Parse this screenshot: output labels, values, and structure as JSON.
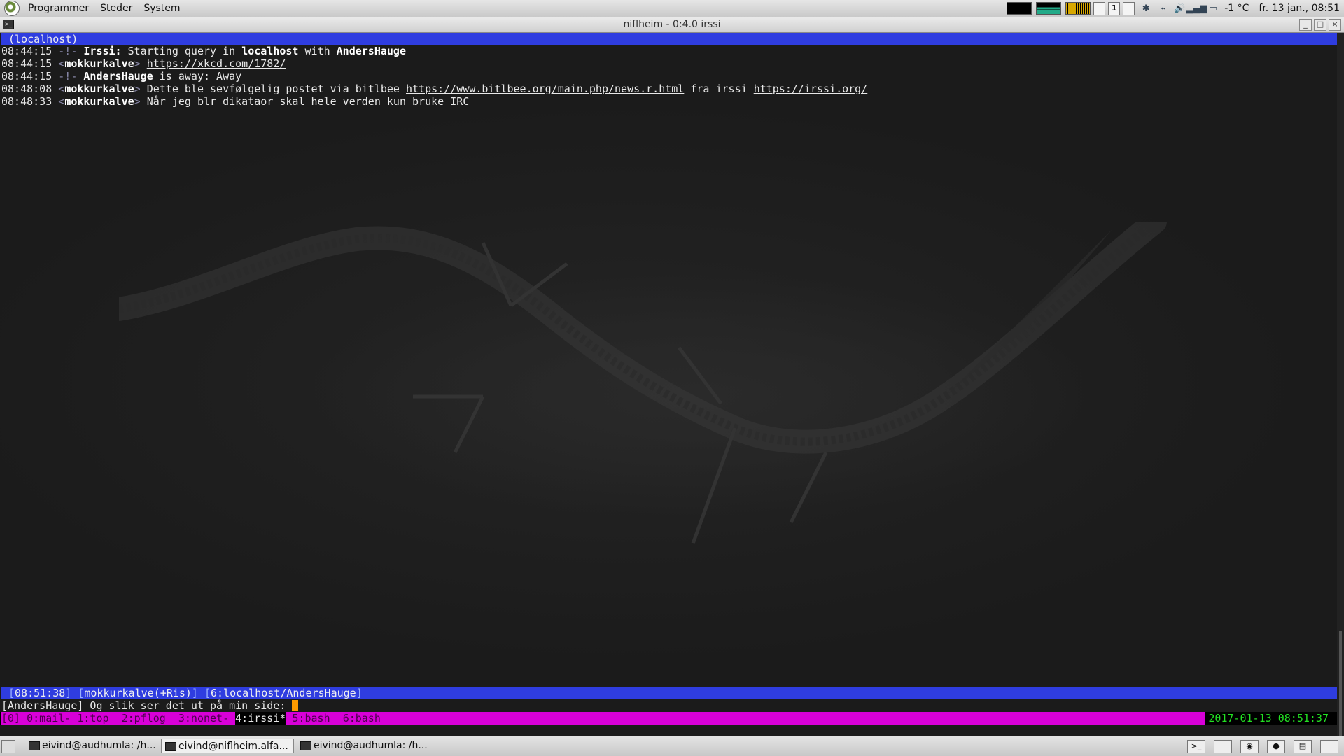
{
  "top_panel": {
    "menus": [
      "Programmer",
      "Steder",
      "System"
    ],
    "workspace_number": "1",
    "temperature": "-1 °C",
    "clock": "fr. 13 jan., 08:51"
  },
  "window": {
    "title": "niflheim - 0:4.0 irssi"
  },
  "irssi": {
    "topic": "(localhost)",
    "messages": [
      {
        "time": "08:44:15",
        "type": "system",
        "prefix": "-!-",
        "parts": [
          {
            "b": "Irssi:"
          },
          {
            "t": " Starting query in "
          },
          {
            "b": "localhost"
          },
          {
            "t": " with "
          },
          {
            "b": "AndersHauge"
          }
        ]
      },
      {
        "time": "08:44:15",
        "type": "nick",
        "nick": "mokkurkalve",
        "parts": [
          {
            "a": "https://xkcd.com/1782/"
          }
        ]
      },
      {
        "time": "08:44:15",
        "type": "system",
        "prefix": "-!-",
        "parts": [
          {
            "b": "AndersHauge"
          },
          {
            "t": " is away: Away"
          }
        ]
      },
      {
        "time": "08:48:08",
        "type": "nick",
        "nick": "mokkurkalve",
        "parts": [
          {
            "t": "Dette ble sevfølgelig postet via bitlbee "
          },
          {
            "a": "https://www.bitlbee.org/main.php/news.r.html"
          },
          {
            "t": " fra irssi "
          },
          {
            "a": "https://irssi.org/"
          }
        ]
      },
      {
        "time": "08:48:33",
        "type": "nick",
        "nick": "mokkurkalve",
        "parts": [
          {
            "t": "Når jeg blr dikataor skal hele verden kun bruke IRC"
          }
        ]
      }
    ],
    "status": {
      "time": "08:51:38",
      "nick": "mokkurkalve(+Ris)",
      "window": "6:localhost/AndersHauge"
    },
    "input": "[AndersHauge] Og slik ser det ut på min side: "
  },
  "tmux": {
    "windows": [
      {
        "label": "[0] ",
        "active": false
      },
      {
        "label": "0:mail- ",
        "active": false
      },
      {
        "label": "1:top  ",
        "active": false
      },
      {
        "label": "2:pflog  ",
        "active": false
      },
      {
        "label": "3:nonet- ",
        "active": false
      },
      {
        "label": "4:irssi*",
        "active": true
      },
      {
        "label": " 5:bash  ",
        "active": false
      },
      {
        "label": "6:bash",
        "active": false
      }
    ],
    "datetime": "2017-01-13 08:51:37"
  },
  "taskbar": {
    "tasks": [
      "eivind@audhumla: /h...",
      "eivind@niflheim.alfa...",
      "eivind@audhumla: /h..."
    ]
  },
  "colors": {
    "irssi_bar": "#2f3de0",
    "tmux_bar": "#d800d8",
    "tmux_date": "#22e022",
    "cursor": "#ff9a00"
  }
}
